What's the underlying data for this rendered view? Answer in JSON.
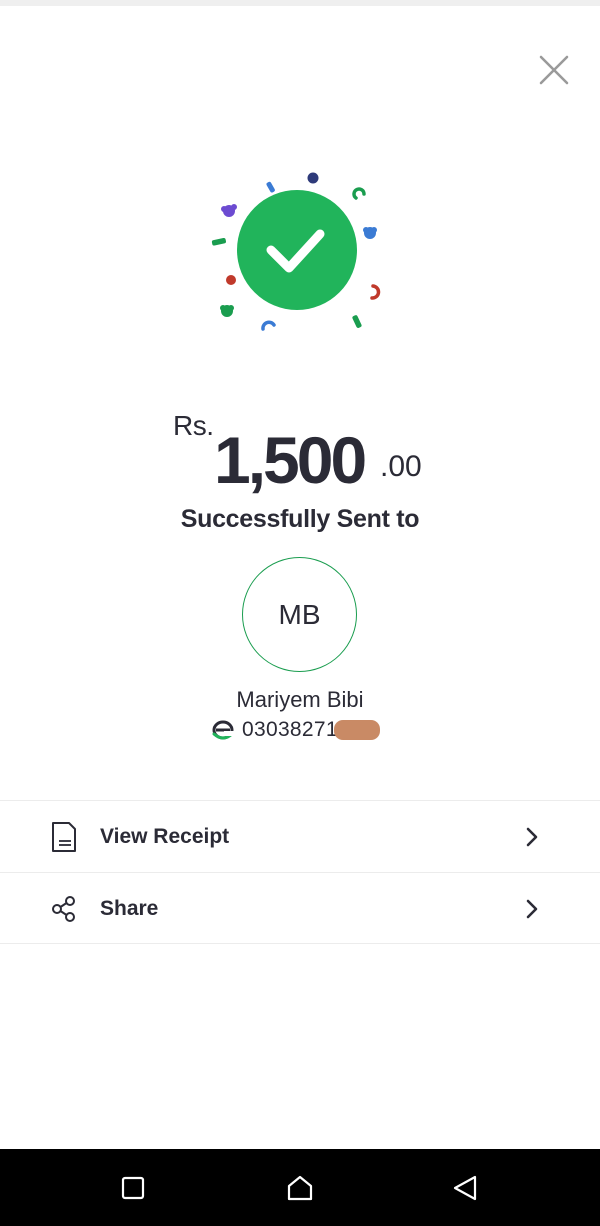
{
  "amount": {
    "currency": "Rs.",
    "whole": "1,500",
    "fraction": ".00"
  },
  "status_text": "Successfully Sent to",
  "recipient": {
    "initials": "MB",
    "name": "Mariyem Bibi",
    "number_visible": "0303827",
    "number_partial": "1"
  },
  "actions": [
    {
      "label": "View Receipt",
      "icon": "receipt-icon"
    },
    {
      "label": "Share",
      "icon": "share-icon"
    }
  ],
  "colors": {
    "success_green": "#21b45b",
    "text_dark": "#2b2b36",
    "avatar_border": "#1a9d4f"
  },
  "nav": {
    "recents_icon": "square-icon",
    "home_icon": "home-icon",
    "back_icon": "triangle-back-icon"
  }
}
